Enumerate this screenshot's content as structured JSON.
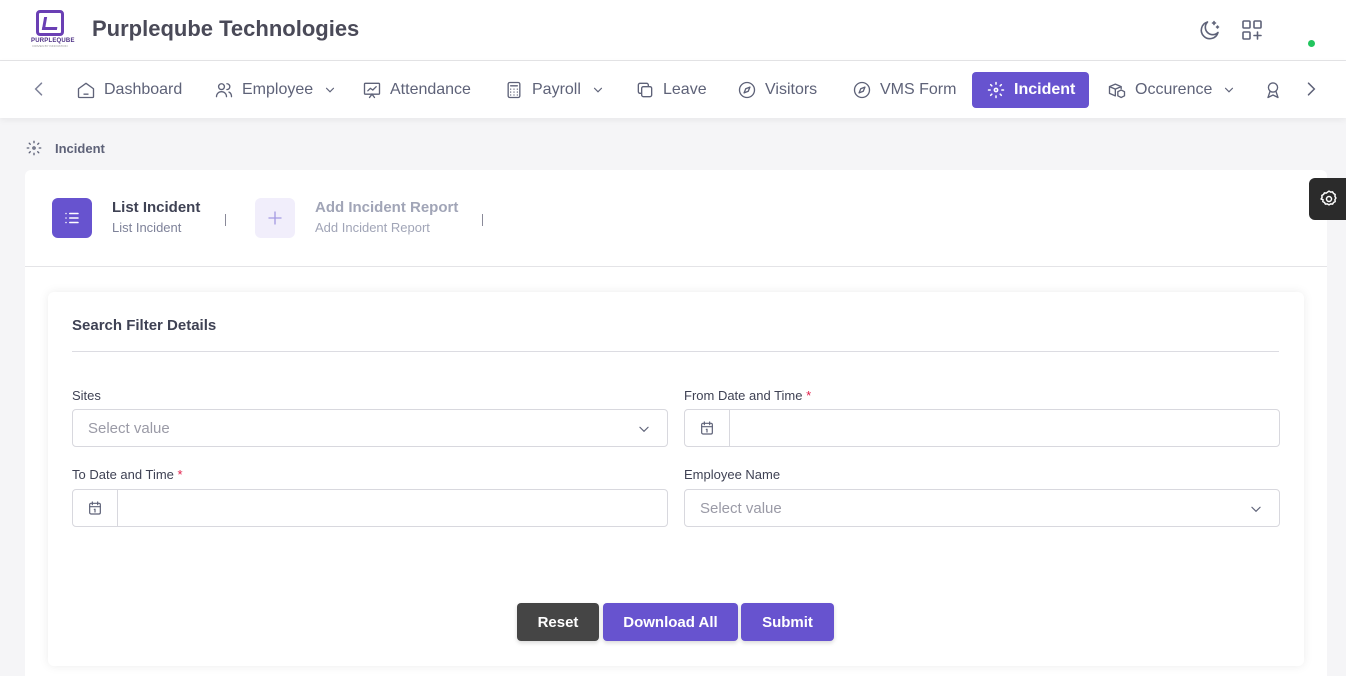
{
  "header": {
    "logo_text": "PURPLEQUBE",
    "logo_sub": "DRIVEN BY INNOVATION",
    "brand": "Purpleqube Technologies",
    "icons": [
      "moon-icon",
      "apps-icon"
    ],
    "status_color": "#22c55e"
  },
  "nav": {
    "items": [
      {
        "label": "Dashboard",
        "icon": "home-icon"
      },
      {
        "label": "Employee",
        "icon": "users-icon",
        "dropdown": true
      },
      {
        "label": "Attendance",
        "icon": "presentation-icon"
      },
      {
        "label": "Payroll",
        "icon": "calculator-icon",
        "dropdown": true
      },
      {
        "label": "Leave",
        "icon": "copy-icon"
      },
      {
        "label": "Visitors",
        "icon": "compass-icon"
      },
      {
        "label": "VMS Form",
        "icon": "compass-icon"
      },
      {
        "label": "Incident",
        "icon": "incident-icon",
        "active": true
      },
      {
        "label": "Occurence",
        "icon": "boxes-icon",
        "dropdown": true
      }
    ],
    "accent": "#6753cf"
  },
  "breadcrumb": {
    "label": "Incident"
  },
  "tabs": [
    {
      "title": "List Incident",
      "subtitle": "List Incident",
      "active": true
    },
    {
      "title": "Add Incident Report",
      "subtitle": "Add Incident Report",
      "active": false
    }
  ],
  "filter": {
    "title": "Search Filter Details",
    "sites": {
      "label": "Sites",
      "placeholder": "Select value"
    },
    "from_date": {
      "label": "From Date and Time",
      "required": "*",
      "value": ""
    },
    "to_date": {
      "label": "To Date and Time",
      "required": "*",
      "value": ""
    },
    "employee": {
      "label": "Employee Name",
      "placeholder": "Select value"
    }
  },
  "buttons": {
    "reset": "Reset",
    "download": "Download All",
    "submit": "Submit"
  }
}
